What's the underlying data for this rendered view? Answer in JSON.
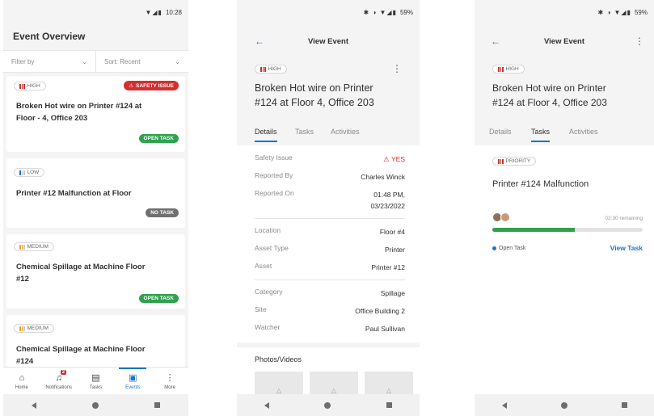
{
  "colors": {
    "accent": "#1a73c8",
    "success": "#2ea24e",
    "danger": "#d32f2f",
    "neutral": "#707070"
  },
  "screen1": {
    "status_time": "10:28",
    "title": "Event Overview",
    "filter": {
      "filter_label": "Filter by",
      "sort_label": "Sort: Recent"
    },
    "cards": [
      {
        "priority": "HIGH",
        "priority_color": "#d32f2f",
        "flag": "SAFETY ISSUE",
        "title_line1": "Broken Hot wire on Printer #124 at",
        "title_line2": "Floor - 4, Office 203",
        "badge": "OPEN TASK"
      },
      {
        "priority": "LOW",
        "priority_color": "#1a73c8",
        "title_line1": "Printer #12 Malfunction at Floor",
        "title_line2": "",
        "badge": "NO TASK"
      },
      {
        "priority": "MEDIUM",
        "priority_color": "#f2a43a",
        "title_line1": "Chemical Spillage at Machine Floor",
        "title_line2": "#12",
        "badge": "OPEN TASK"
      },
      {
        "priority": "MEDIUM",
        "priority_color": "#f2a43a",
        "title_line1": "Chemical Spillage at Machine Floor",
        "title_line2": "#124"
      }
    ],
    "tabs": [
      {
        "label": "Home",
        "icon": "home-icon"
      },
      {
        "label": "Notifications",
        "icon": "bell-icon",
        "count": "2"
      },
      {
        "label": "Tasks",
        "icon": "document-icon"
      },
      {
        "label": "Events",
        "icon": "events-icon"
      },
      {
        "label": "More",
        "icon": "more-icon"
      }
    ]
  },
  "screen2": {
    "status_battery": "59%",
    "title": "View Event",
    "priority": "HIGH",
    "event_line1": "Broken Hot wire on Printer",
    "event_line2": "#124 at Floor 4, Office 203",
    "tabs": [
      "Details",
      "Tasks",
      "Activities"
    ],
    "details": [
      {
        "key": "Safety Issue",
        "value": "YES"
      },
      {
        "key": "Reported By",
        "value": "Charles Winck"
      },
      {
        "key": "Reported On",
        "value": "01:48 PM,",
        "value2": "03/23/2022"
      },
      {
        "key": "Location",
        "value": "Floor #4"
      },
      {
        "key": "Asset Type",
        "value": "Printer"
      },
      {
        "key": "Asset",
        "value": "Printer #12"
      },
      {
        "key": "Category",
        "value": "Spillage"
      },
      {
        "key": "Site",
        "value": "Office Building 2"
      },
      {
        "key": "Watcher",
        "value": "Paul Sullivan"
      }
    ],
    "photos_title": "Photos/Videos"
  },
  "screen3": {
    "status_battery": "59%",
    "title": "View Event",
    "priority": "HIGH",
    "event_line1": "Broken Hot wire on Printer",
    "event_line2": "#124 at Floor 4, Office 203",
    "tabs": [
      "Details",
      "Tasks",
      "Activities"
    ],
    "task": {
      "priority": "PRIORITY",
      "title": "Printer #124 Malfunction",
      "remaining": "02:30 remaining",
      "progress": 0.55,
      "status": "Open Task",
      "link": "View Task"
    }
  }
}
